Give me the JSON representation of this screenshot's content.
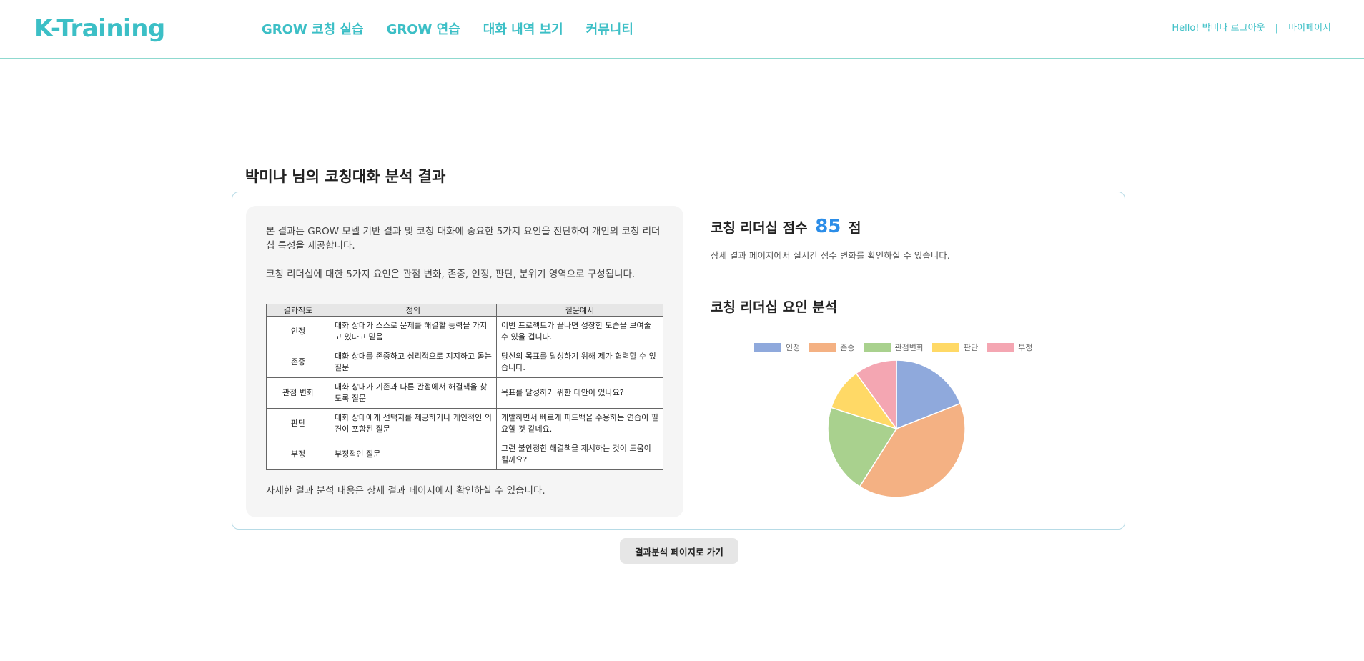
{
  "header": {
    "logo": "K-Training",
    "nav": [
      "GROW 코칭 실습",
      "GROW 연습",
      "대화 내역 보기",
      "커뮤니티"
    ],
    "greeting": "Hello! 박미나",
    "logout": "로그아웃",
    "separator": "|",
    "mypage": "마이페이지"
  },
  "page": {
    "title": "박미나 님의 코칭대화 분석 결과",
    "intro1": "본 결과는 GROW 모델 기반 결과 및 코칭 대화에 중요한 5가지 요인을 진단하여 개인의 코칭 리더십 특성을 제공합니다.",
    "intro2": "코칭 리더십에 대한 5가지 요인은 관점 변화, 존중, 인정, 판단, 분위기 영역으로 구성됩니다.",
    "footnote": "자세한 결과 분석 내용은 상세 결과 페이지에서 확인하실 수 있습니다.",
    "button": "결과분석 페이지로 가기"
  },
  "table": {
    "headers": [
      "결과척도",
      "정의",
      "질문예시"
    ],
    "rows": [
      {
        "scale": "인정",
        "def": "대화 상대가 스스로 문제를 해결할 능력을 가지고 있다고 믿음",
        "example": "이번 프로젝트가 끝나면 성장한 모습을 보여줄 수 있을 겁니다."
      },
      {
        "scale": "존중",
        "def": "대화 상대를 존중하고 심리적으로 지지하고 돕는 질문",
        "example": "당신의 목표를 달성하기 위해 제가 협력할 수 있습니다."
      },
      {
        "scale": "관점 변화",
        "def": "대화 상대가 기존과 다른 관점에서 해결책을 찾도록 질문",
        "example": "목표를 달성하기 위한 대안이 있나요?"
      },
      {
        "scale": "판단",
        "def": "대화 상대에게 선택지를 제공하거나 개인적인 의견이 포함된 질문",
        "example": "개발하면서 빠르게 피드백을 수용하는 연습이 필요할 것 같네요."
      },
      {
        "scale": "부정",
        "def": "부정적인 질문",
        "example": "그런 불안정한 해결책을 제시하는 것이 도움이 될까요?"
      }
    ]
  },
  "score": {
    "label": "코칭 리더십 점수",
    "value": "85",
    "unit": "점",
    "desc": "상세 결과 페이지에서 실시간 점수 변화를 확인하실 수 있습니다."
  },
  "factors": {
    "title": "코칭 리더십 요인 분석"
  },
  "chart_data": {
    "type": "pie",
    "categories": [
      "인정",
      "존중",
      "관점변화",
      "판단",
      "부정"
    ],
    "values": [
      19,
      40,
      21,
      10,
      10
    ],
    "colors": [
      "#8fa9dc",
      "#f4b183",
      "#a9d18e",
      "#ffd966",
      "#f4a6b2"
    ],
    "legend": "top"
  }
}
